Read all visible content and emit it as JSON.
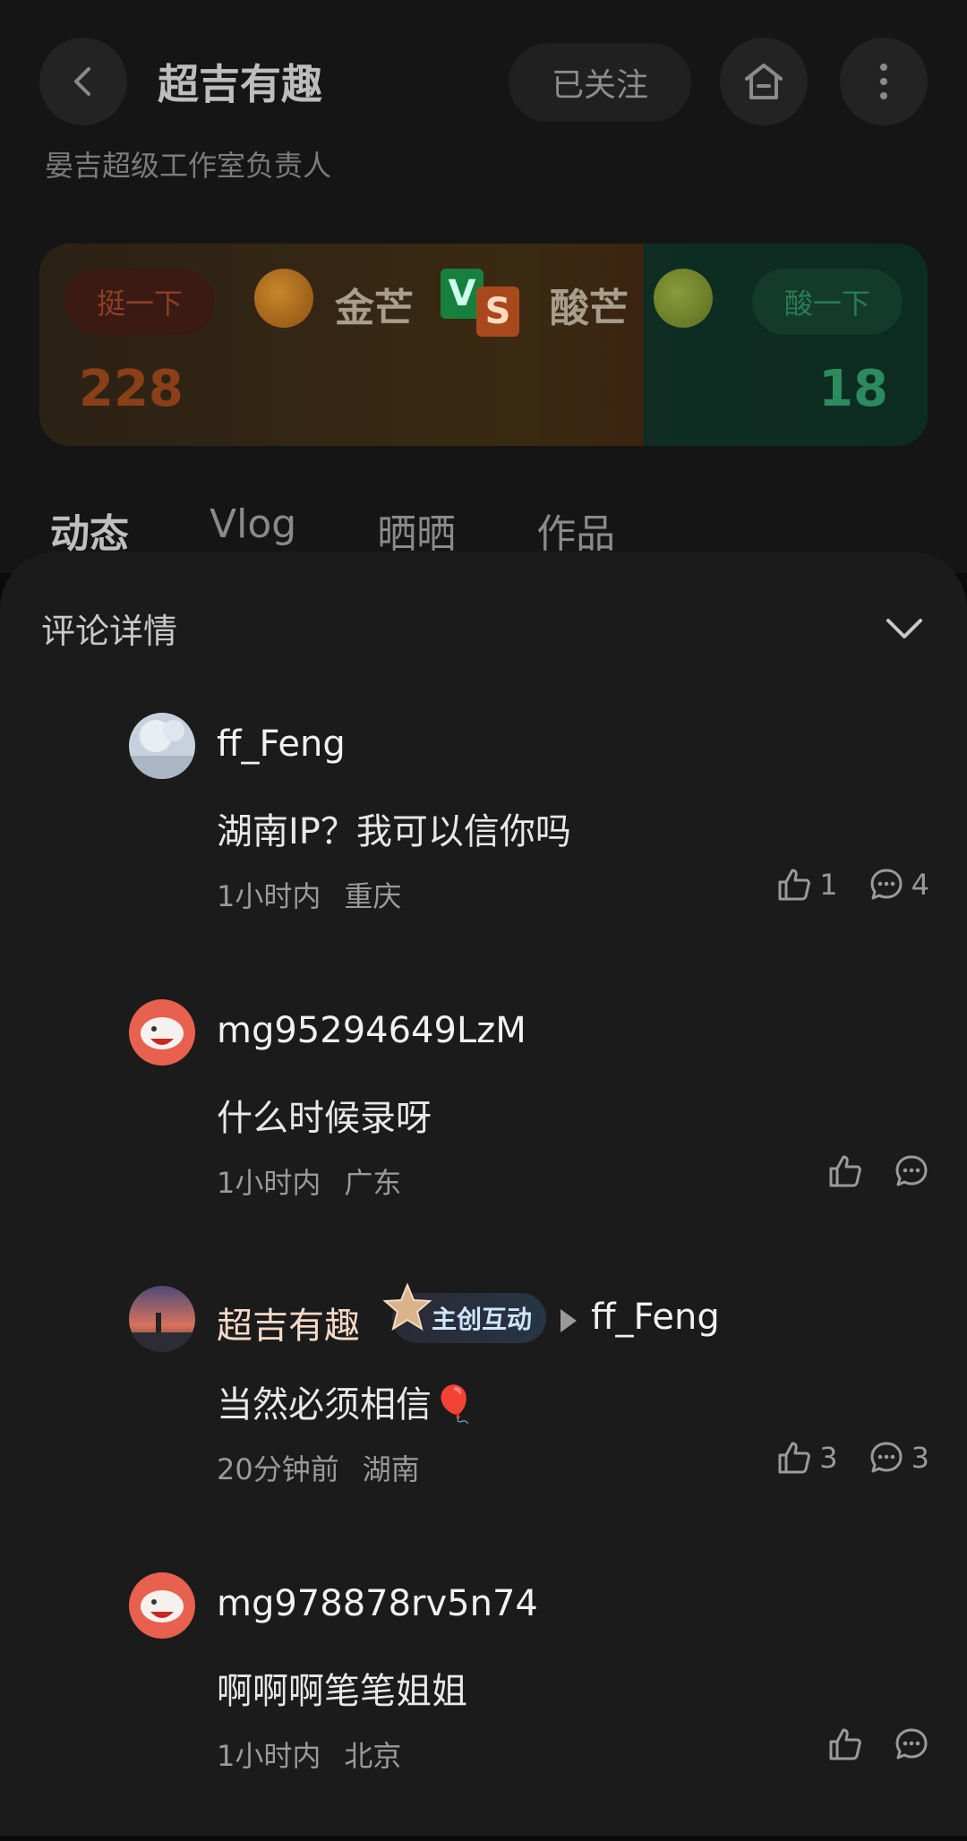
{
  "background": {
    "title": "超吉有趣",
    "follow_label": "已关注",
    "subtitle": "晏吉超级工作室负责人",
    "vs": {
      "left_button": "挺一下",
      "left_name": "金芒",
      "left_count": "228",
      "right_button": "酸一下",
      "right_name": "酸芒",
      "right_count": "18",
      "badge_v": "V",
      "badge_s": "S"
    },
    "tabs": [
      "动态",
      "Vlog",
      "晒晒",
      "作品"
    ]
  },
  "sheet": {
    "title": "评论详情",
    "comments": [
      {
        "username": "ff_Feng",
        "text": "湖南IP？我可以信你吗",
        "time": "1小时内",
        "location": "重庆",
        "likes": "1",
        "replies": "4",
        "avatar_color": "#b9c4d2"
      },
      {
        "username": "mg95294649LzM",
        "text": "什么时候录呀",
        "time": "1小时内",
        "location": "广东",
        "likes": "",
        "replies": "",
        "avatar_color": "#e85a4a"
      },
      {
        "username": "超吉有趣",
        "badge": "主创互动",
        "reply_to": "ff_Feng",
        "text": "当然必须相信🎈",
        "time": "20分钟前",
        "location": "湖南",
        "likes": "3",
        "replies": "3",
        "avatar_color": "#6c5a8a"
      },
      {
        "username": "mg978878rv5n74",
        "text": "啊啊啊笔笔姐姐",
        "time": "1小时内",
        "location": "北京",
        "likes": "",
        "replies": "",
        "avatar_color": "#e85a4a"
      }
    ]
  }
}
